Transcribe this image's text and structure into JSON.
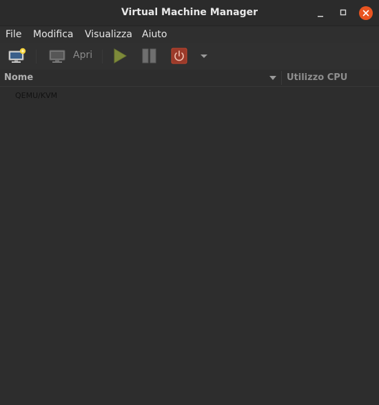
{
  "window": {
    "title": "Virtual Machine Manager",
    "controls": [
      "minimize-icon",
      "maximize-icon",
      "close-icon"
    ],
    "close_color": "#e95420"
  },
  "menubar": {
    "items": [
      "File",
      "Modifica",
      "Visualizza",
      "Aiuto"
    ]
  },
  "toolbar": {
    "new_vm_icon": "new-vm-icon",
    "open_label": "Apri",
    "open_icon": "monitor-icon",
    "run_icon": "play-icon",
    "pause_icon": "pause-icon",
    "shutdown_icon": "power-icon",
    "dropdown_icon": "chevron-down-icon",
    "shutdown_color": "#c4452d",
    "run_color": "#7d8a3a"
  },
  "columns": {
    "name": "Nome",
    "cpu": "Utilizzo CPU",
    "sort_icon": "sort-down-icon"
  },
  "connections": [
    {
      "label": "QEMU/KVM"
    }
  ]
}
